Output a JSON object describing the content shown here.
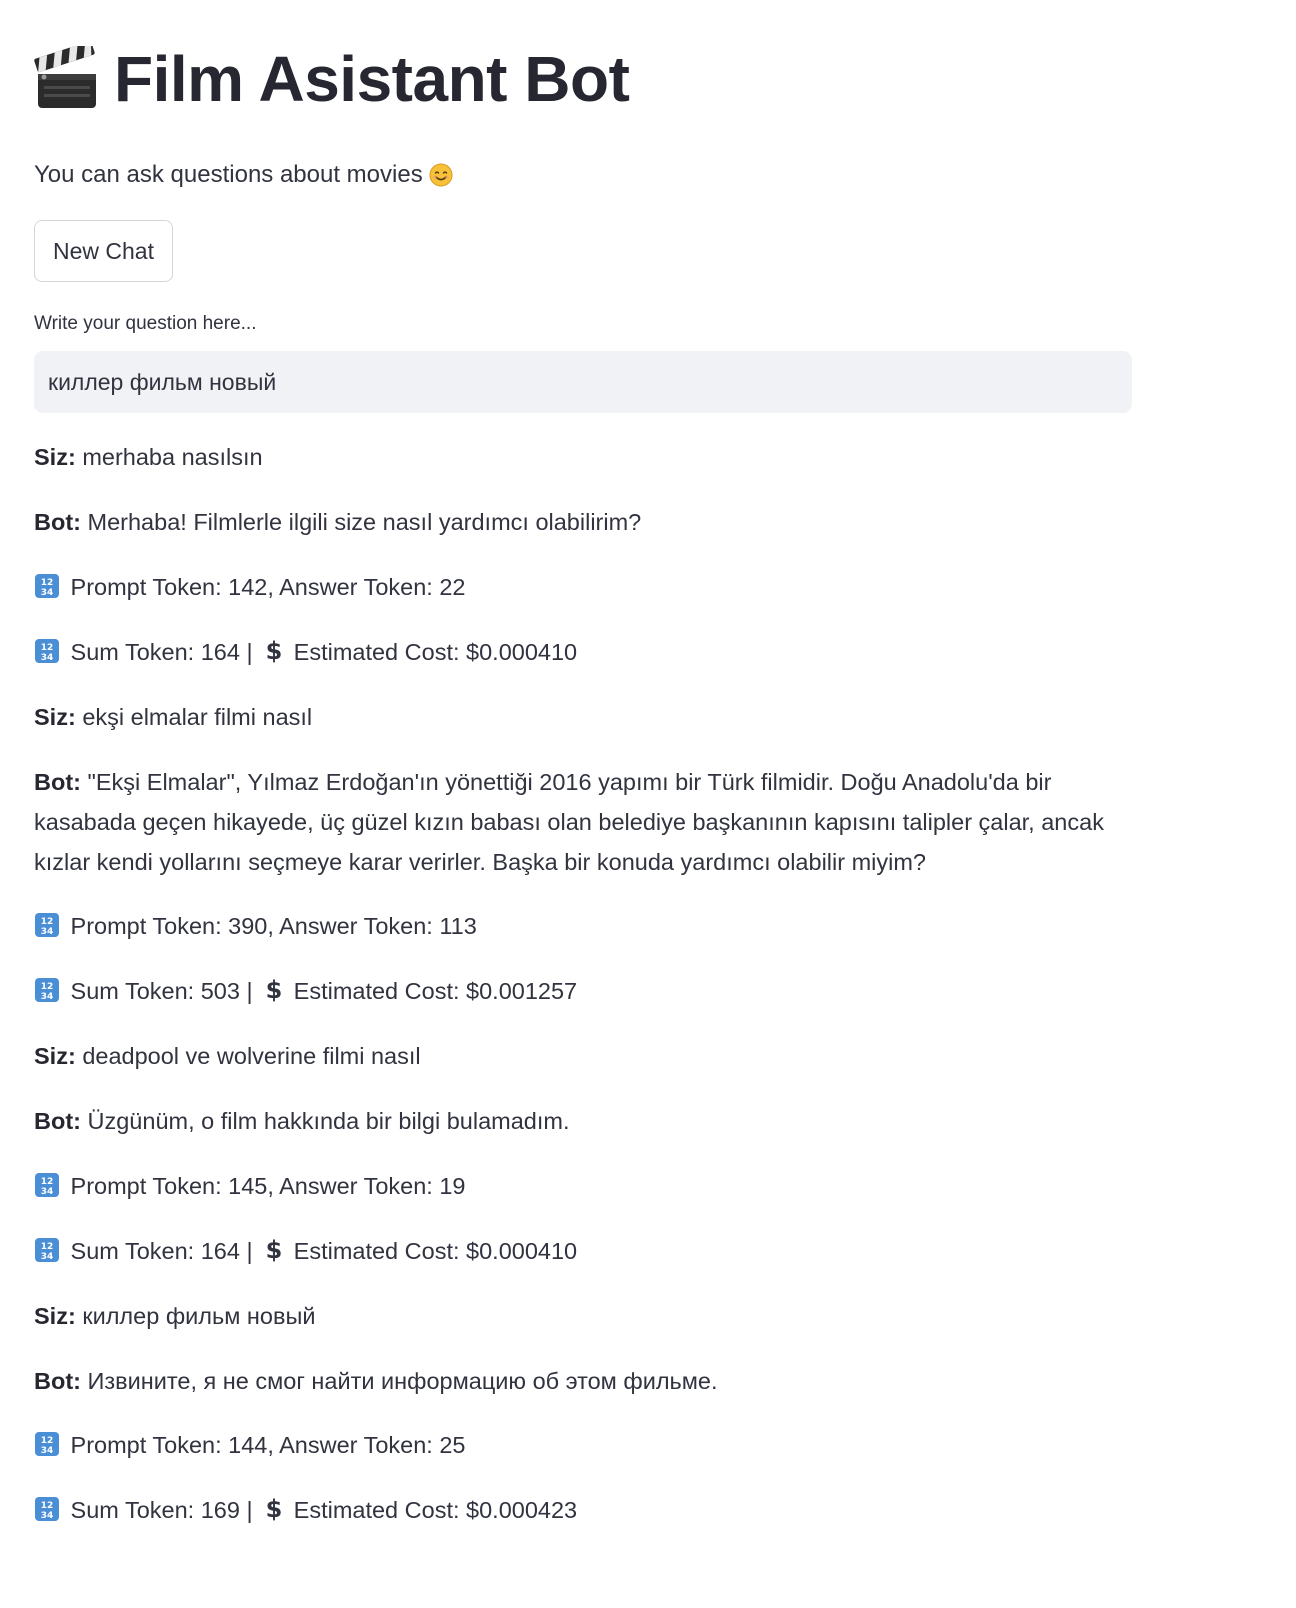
{
  "header": {
    "title": "Film Asistant Bot",
    "title_icon": "clapper-board-icon",
    "subtitle": "You can ask questions about movies",
    "subtitle_icon": "smiling-face-icon"
  },
  "toolbar": {
    "new_chat_label": "New Chat"
  },
  "question": {
    "label": "Write your question here...",
    "value": "киллер фильм новый"
  },
  "messages": [
    {
      "speaker": "Siz:",
      "text": "merhaba nasılsın"
    },
    {
      "speaker": "Bot:",
      "text": "Merhaba! Filmlerle ilgili size nasıl yardımcı olabilirim?"
    },
    {
      "tokens": "Prompt Token: 142, Answer Token: 22"
    },
    {
      "sum": "Sum Token: 164 |",
      "cost": "Estimated Cost: $0.000410"
    },
    {
      "speaker": "Siz:",
      "text": "ekşi elmalar filmi nasıl"
    },
    {
      "speaker": "Bot:",
      "text": "\"Ekşi Elmalar\", Yılmaz Erdoğan'ın yönettiği 2016 yapımı bir Türk filmidir. Doğu Anadolu'da bir kasabada geçen hikayede, üç güzel kızın babası olan belediye başkanının kapısını talipler çalar, ancak kızlar kendi yollarını seçmeye karar verirler. Başka bir konuda yardımcı olabilir miyim?"
    },
    {
      "tokens": "Prompt Token: 390, Answer Token: 113"
    },
    {
      "sum": "Sum Token: 503 |",
      "cost": "Estimated Cost: $0.001257"
    },
    {
      "speaker": "Siz:",
      "text": "deadpool ve wolverine filmi nasıl"
    },
    {
      "speaker": "Bot:",
      "text": "Üzgünüm, o film hakkında bir bilgi bulamadım."
    },
    {
      "tokens": "Prompt Token: 145, Answer Token: 19"
    },
    {
      "sum": "Sum Token: 164 |",
      "cost": "Estimated Cost: $0.000410"
    },
    {
      "speaker": "Siz:",
      "text": "киллер фильм новый"
    },
    {
      "speaker": "Bot:",
      "text": "Извините, я не смог найти информацию об этом фильме."
    },
    {
      "tokens": "Prompt Token: 144, Answer Token: 25"
    },
    {
      "sum": "Sum Token: 169 |",
      "cost": "Estimated Cost: $0.000423"
    }
  ],
  "icons": {
    "numbers": "input-numbers-icon",
    "dollar": "heavy-dollar-sign-icon"
  },
  "colors": {
    "text": "#31333f",
    "input_bg": "#f0f2f6",
    "button_border": "#d6d6d9",
    "numbers_icon_blue": "#4a8fd6"
  }
}
